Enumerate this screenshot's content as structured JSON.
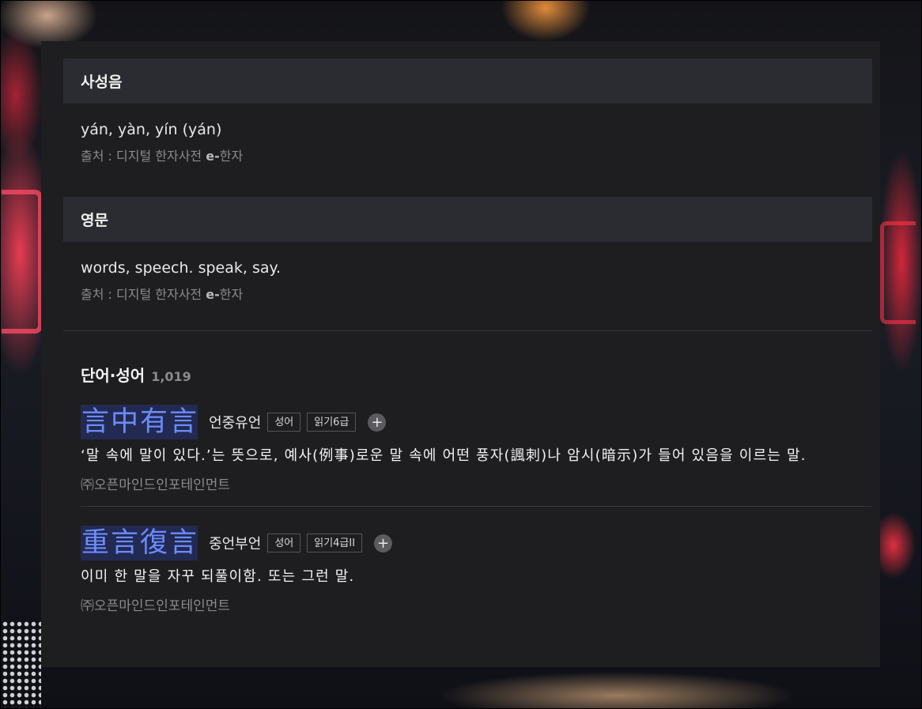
{
  "sections": [
    {
      "title": "사성음",
      "body": "yán, yàn, yín (yán)",
      "source_prefix": "출처 : 디지털 한자사전 ",
      "source_strong": "e-",
      "source_suffix": "한자"
    },
    {
      "title": "영문",
      "body": "words, speech. speak, say.",
      "source_prefix": "출처 : 디지털 한자사전 ",
      "source_strong": "e-",
      "source_suffix": "한자"
    }
  ],
  "words": {
    "title": "단어·성어",
    "count": "1,019",
    "entries": [
      {
        "hanja": [
          "言",
          "中",
          "有",
          "言"
        ],
        "reading": "언중유언",
        "tags": [
          "성어",
          "읽기6급"
        ],
        "plus": "+",
        "meaning": "‘말 속에 말이 있다.’는 뜻으로, 예사(例事)로운 말 속에 어떤 풍자(諷刺)나 암시(暗示)가 들어 있음을 이르는 말.",
        "copyright": "㈜오픈마인드인포테인먼트"
      },
      {
        "hanja": [
          "重",
          "言",
          "復",
          "言"
        ],
        "reading": "중언부언",
        "tags": [
          "성어",
          "읽기4급II"
        ],
        "plus": "+",
        "meaning": "이미 한 말을 자꾸 되풀이함. 또는 그런 말.",
        "copyright": "㈜오픈마인드인포테인먼트"
      }
    ]
  },
  "colors": {
    "panel_bg": "#1e1e20",
    "section_head_bg": "#2b2c31",
    "hanja_accent": "#6c8cff"
  }
}
